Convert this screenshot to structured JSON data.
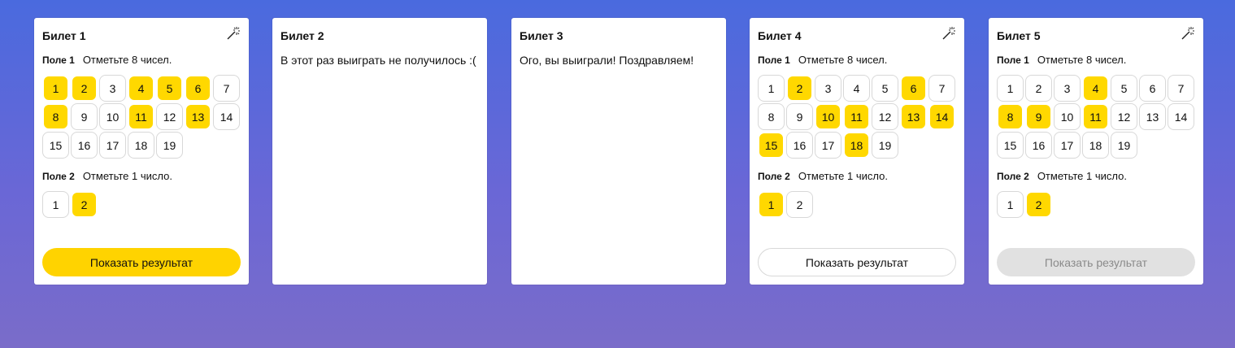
{
  "tickets": [
    {
      "title": "Билет 1",
      "has_wand": true,
      "field1": {
        "name": "Поле 1",
        "instruction": "Отметьте 8 чисел.",
        "numbers": [
          1,
          2,
          3,
          4,
          5,
          6,
          7,
          8,
          9,
          10,
          11,
          12,
          13,
          14,
          15,
          16,
          17,
          18,
          19
        ],
        "selected": [
          1,
          2,
          4,
          5,
          6,
          8,
          11,
          13
        ]
      },
      "field2": {
        "name": "Поле 2",
        "instruction": "Отметьте 1 число.",
        "numbers": [
          1,
          2
        ],
        "selected": [
          2
        ]
      },
      "button": {
        "label": "Показать результат",
        "state": "primary"
      }
    },
    {
      "title": "Билет 2",
      "message": "В этот раз выиграть не получилось :("
    },
    {
      "title": "Билет 3",
      "message": "Ого, вы выиграли! Поздравляем!"
    },
    {
      "title": "Билет 4",
      "has_wand": true,
      "field1": {
        "name": "Поле 1",
        "instruction": "Отметьте 8 чисел.",
        "numbers": [
          1,
          2,
          3,
          4,
          5,
          6,
          7,
          8,
          9,
          10,
          11,
          12,
          13,
          14,
          15,
          16,
          17,
          18,
          19
        ],
        "selected": [
          2,
          6,
          10,
          11,
          13,
          14,
          15,
          18
        ]
      },
      "field2": {
        "name": "Поле 2",
        "instruction": "Отметьте 1 число.",
        "numbers": [
          1,
          2
        ],
        "selected": [
          1
        ]
      },
      "button": {
        "label": "Показать результат",
        "state": "outline"
      }
    },
    {
      "title": "Билет 5",
      "has_wand": true,
      "field1": {
        "name": "Поле 1",
        "instruction": "Отметьте 8 чисел.",
        "numbers": [
          1,
          2,
          3,
          4,
          5,
          6,
          7,
          8,
          9,
          10,
          11,
          12,
          13,
          14,
          15,
          16,
          17,
          18,
          19
        ],
        "selected": [
          4,
          8,
          9,
          11
        ]
      },
      "field2": {
        "name": "Поле 2",
        "instruction": "Отметьте 1 число.",
        "numbers": [
          1,
          2
        ],
        "selected": [
          2
        ]
      },
      "button": {
        "label": "Показать результат",
        "state": "disabled"
      }
    }
  ],
  "colors": {
    "selected": "#ffd800",
    "button_primary": "#ffd300",
    "button_disabled": "#e1e1e1"
  },
  "icons": {
    "wand": "magic-wand-icon"
  }
}
